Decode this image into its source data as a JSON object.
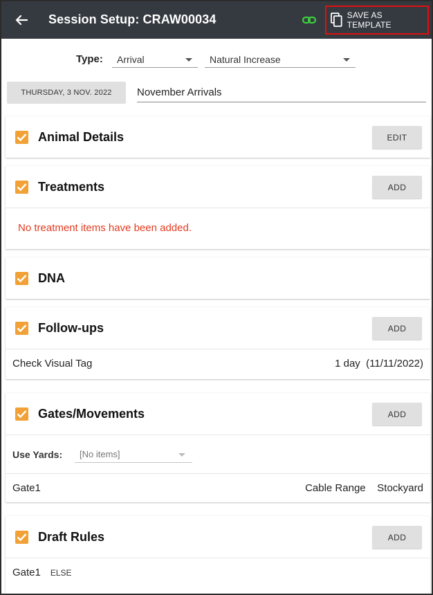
{
  "header": {
    "title": "Session Setup: CRAW00034",
    "save_template_label": "SAVE AS TEMPLATE",
    "back_icon": "arrow-left-icon",
    "link_icon": "link-icon",
    "copy_icon": "copy-icon"
  },
  "form": {
    "type_label": "Type:",
    "type_value": "Arrival",
    "subtype_value": "Natural Increase",
    "date_button": "THURSDAY, 3 NOV. 2022",
    "session_name": "November Arrivals"
  },
  "sections": {
    "animal_details": {
      "title": "Animal Details",
      "button": "EDIT",
      "checked": true
    },
    "treatments": {
      "title": "Treatments",
      "button": "ADD",
      "checked": true,
      "empty_message": "No treatment items have been added."
    },
    "dna": {
      "title": "DNA",
      "checked": true
    },
    "followups": {
      "title": "Follow-ups",
      "button": "ADD",
      "checked": true,
      "items": [
        {
          "name": "Check Visual Tag",
          "duration": "1 day",
          "date": "(11/11/2022)"
        }
      ]
    },
    "gates": {
      "title": "Gates/Movements",
      "button": "ADD",
      "checked": true,
      "use_yards_label": "Use Yards:",
      "use_yards_value": "[No items]",
      "items": [
        {
          "gate": "Gate1",
          "range": "Cable Range",
          "destination": "Stockyard"
        }
      ]
    },
    "draft_rules": {
      "title": "Draft Rules",
      "button": "ADD",
      "checked": true,
      "items": [
        {
          "gate": "Gate1",
          "rule": "ELSE"
        }
      ]
    }
  },
  "colors": {
    "appbar": "#343a40",
    "checkbox": "#f1a135",
    "warning": "#e23b1f",
    "link_icon": "#3ecf3e",
    "highlight_border": "#e01010"
  }
}
